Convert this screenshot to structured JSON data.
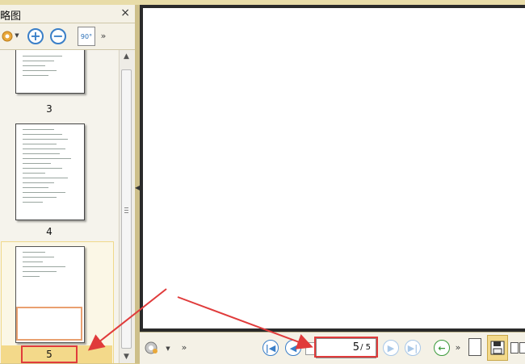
{
  "thumbnail_panel": {
    "title": "略图",
    "close_label": "×",
    "toolbar": {
      "rotate_label": "90°"
    },
    "thumbnails": [
      {
        "label": "3"
      },
      {
        "label": "4"
      },
      {
        "label": "5"
      }
    ]
  },
  "navigation": {
    "current_page": "5",
    "total_pages": "/ 5"
  },
  "colors": {
    "accent": "#3a7fc8",
    "highlight": "#e03b3b",
    "selected": "#f3d98a"
  },
  "icons": [
    "gear-icon",
    "zoom-in-icon",
    "zoom-out-icon",
    "rotate-icon",
    "more-icon",
    "first-page-icon",
    "previous-page-icon",
    "next-page-icon",
    "last-page-icon",
    "back-icon",
    "single-page-icon",
    "save-icon"
  ]
}
